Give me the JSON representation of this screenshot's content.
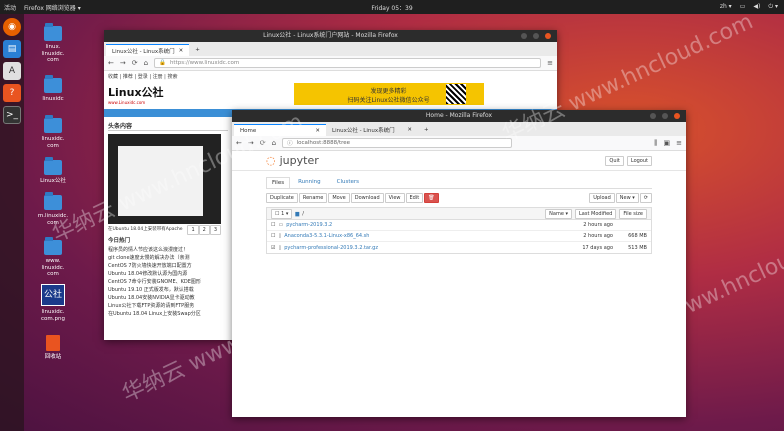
{
  "topbar": {
    "activities": "活动",
    "app": "Firefox 网络浏览器 ▾",
    "clock": "Friday 05：39",
    "lang": "zh ▾"
  },
  "desktop": [
    {
      "label": "linux.\nlinuxidc.\ncom"
    },
    {
      "label": "linuxidc"
    },
    {
      "label": "linuxidc.\ncom"
    },
    {
      "label": "Linux公社"
    },
    {
      "label": "m.linuxidc.\ncom"
    },
    {
      "label": "www.\nlinuxidc.\ncom"
    },
    {
      "label": "linuxidc.\ncom.png"
    },
    {
      "label": "回收站"
    }
  ],
  "back_window": {
    "title": "Linux公社 - Linux系统门户网站 - Mozilla Firefox",
    "tab": "Linux公社 - Linux系统门",
    "url": "https://www.linuxidc.com",
    "menu": "收藏 | 推荐 | 登录 | 注册 | 搜索",
    "logo": "Linux公社",
    "logo_sub": "www.Linuxidc.com",
    "banner1": "发现更多精彩",
    "banner2": "扫码关注Linux公社微信公众号",
    "section": "头条内容",
    "caption": "在Ubuntu 18.04上安装带有Apache",
    "pages": [
      "1",
      "2",
      "3"
    ],
    "today": "今日热门",
    "list": [
      "程序员的情人节应该这么浪漫度过！",
      "git clone速度太慢的解决办法（亲测",
      "CentOS 7防火墙快速开放端口配置方",
      "Ubuntu 18.04修改默认源为国内源",
      "CentOS 7命令行安装GNOME、KDE图形",
      "Ubuntu 19.10 正式版发布，默认搭载",
      "Ubuntu 18.04安装NVIDIA显卡驱动教",
      "Linux公社下载FTP资源的请到FTP服务",
      "在Ubuntu 18.04 Linux上安装Swap分区"
    ]
  },
  "front_window": {
    "title": "Home - Mozilla Firefox",
    "tabs": [
      "Home",
      "Linux公社 - Linux系统门"
    ],
    "url": "localhost:8888/tree",
    "brand": "jupyter",
    "quit": "Quit",
    "logout": "Logout",
    "nav_tabs": [
      "Files",
      "Running",
      "Clusters"
    ],
    "actions": [
      "Duplicate",
      "Rename",
      "Move",
      "Download",
      "View",
      "Edit"
    ],
    "upload": "Upload",
    "new": "New ▾",
    "count": "1",
    "path": "/",
    "headers": [
      "Name ▾",
      "Last Modified",
      "File size"
    ],
    "rows": [
      {
        "name": "pycharm-2019.3.2",
        "modified": "2 hours ago",
        "size": "",
        "checked": false
      },
      {
        "name": "Anaconda3-5.3.1-Linux-x86_64.sh",
        "modified": "2 hours ago",
        "size": "668 MB",
        "checked": false
      },
      {
        "name": "pycharm-professional-2019.3.2.tar.gz",
        "modified": "17 days ago",
        "size": "513 MB",
        "checked": true
      }
    ]
  },
  "watermark": "华纳云 www.hncloud.com"
}
